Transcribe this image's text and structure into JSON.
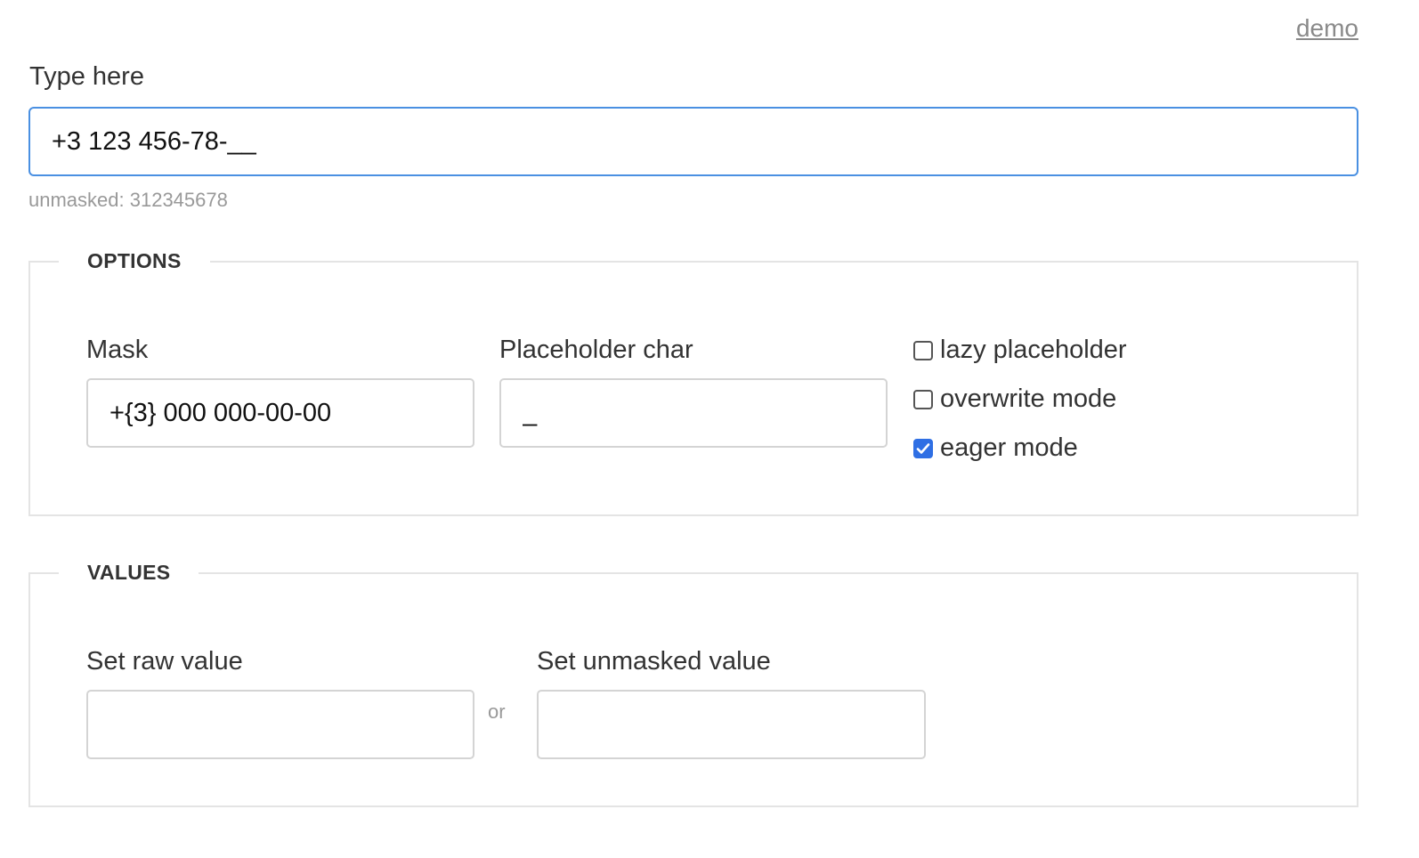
{
  "header": {
    "demo_link": "demo"
  },
  "main": {
    "label": "Type here",
    "value": "+3 123 456-78-__",
    "unmasked_prefix": "unmasked: ",
    "unmasked_value": "312345678"
  },
  "options": {
    "legend": "OPTIONS",
    "mask_label": "Mask",
    "mask_value": "+{3} 000 000-00-00",
    "placeholder_char_label": "Placeholder char",
    "placeholder_char_value": "_",
    "checkboxes": [
      {
        "label": "lazy placeholder",
        "checked": false
      },
      {
        "label": "overwrite mode",
        "checked": false
      },
      {
        "label": "eager mode",
        "checked": true
      }
    ]
  },
  "values": {
    "legend": "VALUES",
    "raw_label": "Set raw value",
    "raw_value": "",
    "or_text": "or",
    "unmasked_label": "Set unmasked value",
    "unmasked_value": ""
  },
  "colors": {
    "focus_border": "#4a90e2",
    "checkbox_checked": "#2f6fe4",
    "muted_text": "#999999"
  }
}
